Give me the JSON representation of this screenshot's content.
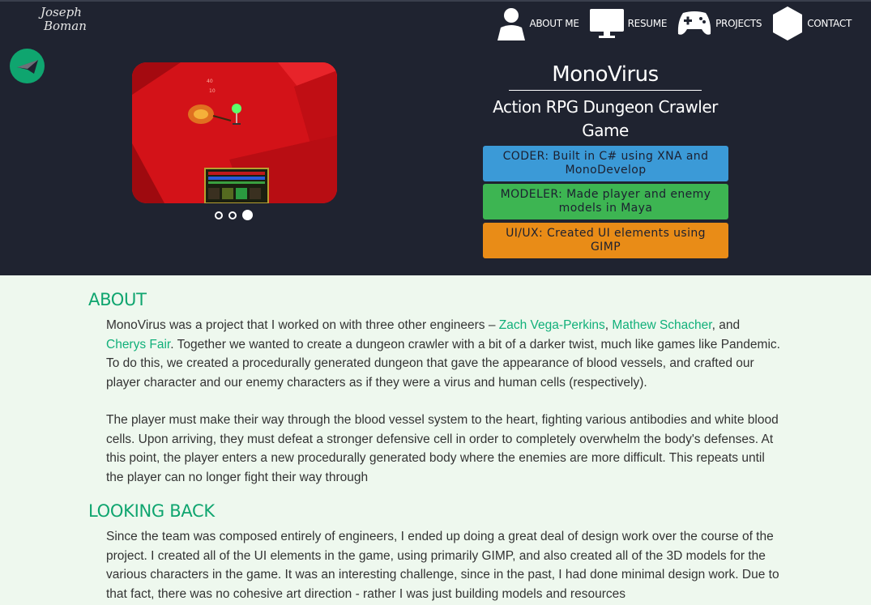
{
  "logo": {
    "line1": "Joseph",
    "line2": "Boman"
  },
  "nav": [
    {
      "label": "ABOUT ME",
      "icon": "person-icon"
    },
    {
      "label": "RESUME",
      "icon": "monitor-icon"
    },
    {
      "label": "PROJECTS",
      "icon": "gamepad-icon"
    },
    {
      "label": "CONTACT",
      "icon": "hexagon-icon"
    }
  ],
  "project": {
    "title": "MonoVirus",
    "subtitle": "Action RPG Dungeon Crawler Game",
    "roles": {
      "coder": "CODER: Built in C# using XNA and MonoDevelop",
      "modeler": "MODELER: Made player and enemy models in Maya",
      "ui": "UI/UX: Created UI elements using GIMP"
    },
    "carousel": {
      "slides": 3,
      "active": 3
    },
    "screenshot_numbers": {
      "top": "40",
      "bottom": "10"
    }
  },
  "about": {
    "heading": "ABOUT",
    "p1_start": "MonoVirus was a project that I worked on with three other engineers – ",
    "link1": "Zach Vega-Perkins",
    "sep1": ", ",
    "link2": "Mathew Schacher",
    "sep2": ", and ",
    "link3": "Cherys Fair",
    "p1_end": ". Together we wanted to create a dungeon crawler with a bit of a darker twist, much like games like Pandemic. To do this, we created a procedurally generated dungeon that gave the appearance of blood vessels, and crafted our player character and our enemy characters as if they were a virus and human cells (respectively).",
    "p2": "The player must make their way through the blood vessel system to the heart, fighting various antibodies and white blood cells. Upon arriving, they must defeat a stronger defensive cell in order to completely overwhelm the body's defenses. At this point, the player enters a new procedurally generated body where the enemies are more difficult. This repeats until the player can no longer fight their way through"
  },
  "looking_back": {
    "heading": "LOOKING BACK",
    "p1": "Since the team was composed entirely of engineers, I ended up doing a great deal of design work over the course of the project. I created all of the UI elements in the game, using primarily GIMP, and also created all of the 3D models for the various characters in the game. It was an interesting challenge, since in the past, I had done minimal design work. Due to that fact, there was no cohesive art direction - rather I was just building models and resources"
  },
  "colors": {
    "nav_bg": "#1f2330",
    "accent_green": "#0fa56f",
    "coder_blue": "#3b9ad7",
    "modeler_green": "#3db552",
    "ui_orange": "#e98c17",
    "content_bg": "#eef8ee"
  }
}
